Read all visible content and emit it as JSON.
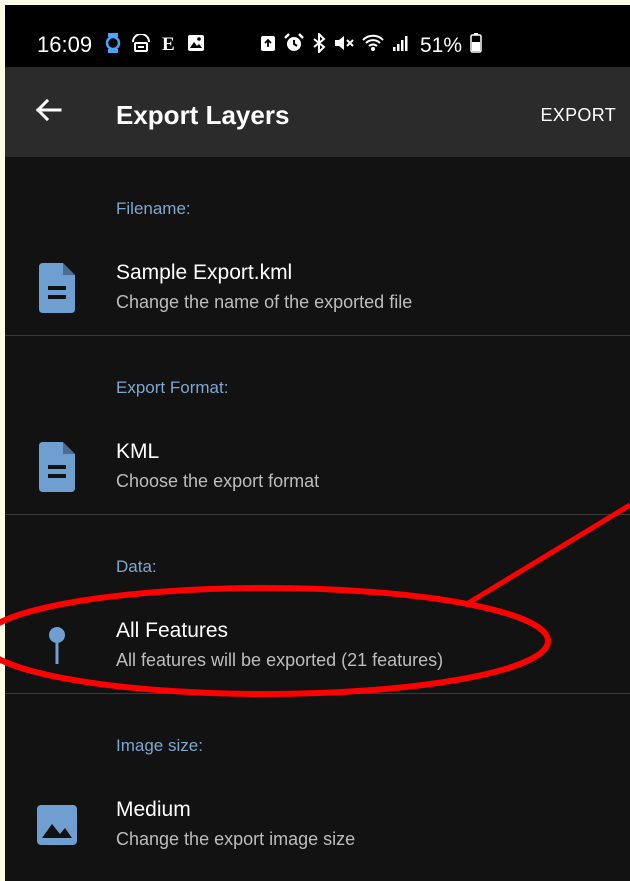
{
  "status": {
    "time": "16:09",
    "battery": "51%",
    "icons_left": [
      "watch-icon",
      "wifi-calling-icon",
      "e-icon",
      "image-icon"
    ],
    "icons_right": [
      "recycle-icon",
      "alarm-icon",
      "bluetooth-icon",
      "mute-icon",
      "wifi-icon",
      "signal-icon",
      "battery-icon"
    ]
  },
  "appbar": {
    "title": "Export Layers",
    "action_label": "EXPORT",
    "back_icon": "arrow-back-icon"
  },
  "sections": [
    {
      "header": "Filename:",
      "title": "Sample Export.kml",
      "subtitle": "Change the name of the exported file",
      "icon": "document-icon"
    },
    {
      "header": "Export Format:",
      "title": "KML",
      "subtitle": "Choose the export format",
      "icon": "document-icon"
    },
    {
      "header": "Data:",
      "title": "All Features",
      "subtitle": "All features will be exported (21 features)",
      "icon": "pin-icon"
    },
    {
      "header": "Image size:",
      "title": "Medium",
      "subtitle": "Change the export image size",
      "icon": "image-icon"
    }
  ],
  "colors": {
    "background": "#121212",
    "appbar": "#2b2b2b",
    "header_text": "#7fa7cf",
    "icon": "#6f9fd1",
    "annotation": "#ff0000",
    "frame": "#fbfbe6"
  }
}
